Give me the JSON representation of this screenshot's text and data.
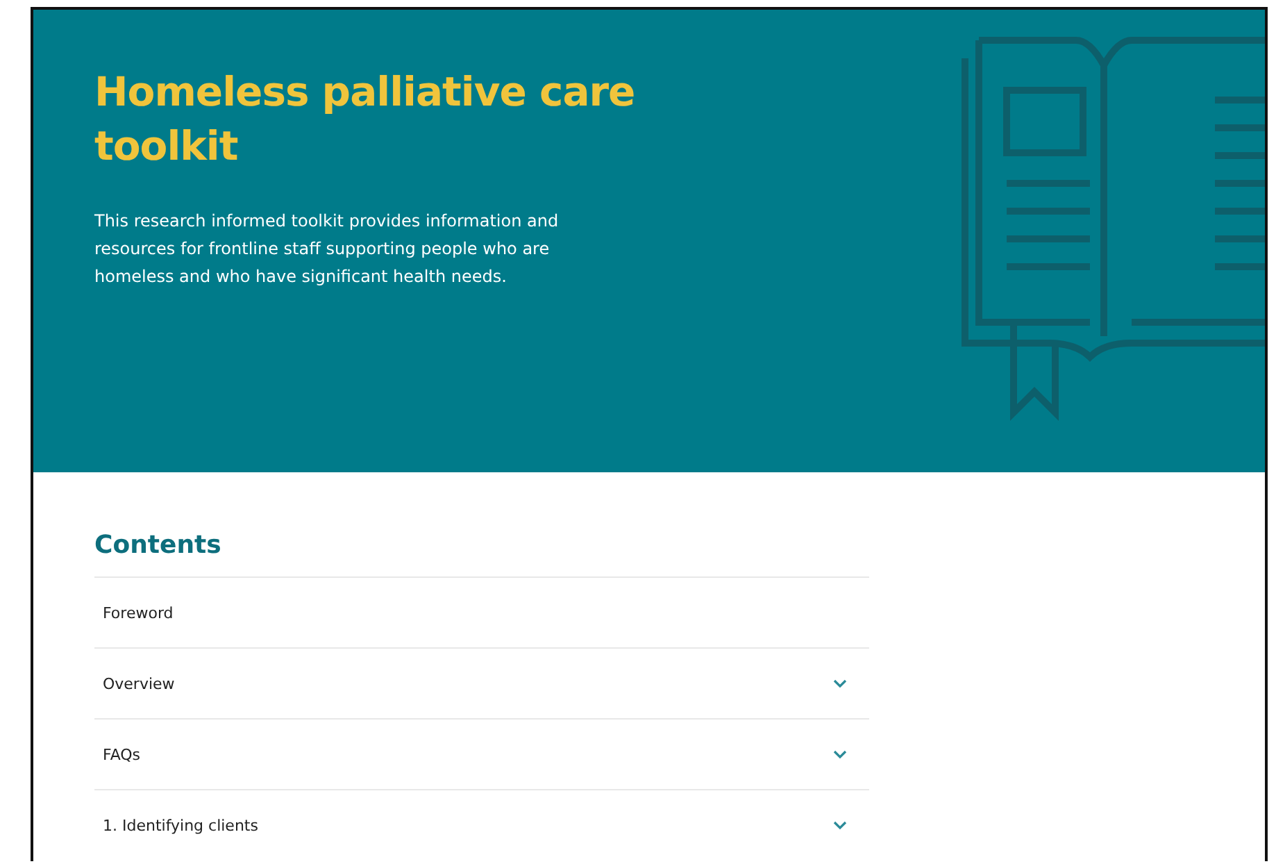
{
  "banner": {
    "title": "Homeless palliative care toolkit",
    "description": "This research informed toolkit provides information and resources for frontline staff supporting people who are homeless and who have significant health needs."
  },
  "contents": {
    "heading": "Contents",
    "items": [
      {
        "label": "Foreword",
        "expandable": false
      },
      {
        "label": "Overview",
        "expandable": true
      },
      {
        "label": "FAQs",
        "expandable": true
      },
      {
        "label": "1. Identifying clients",
        "expandable": true
      }
    ]
  }
}
